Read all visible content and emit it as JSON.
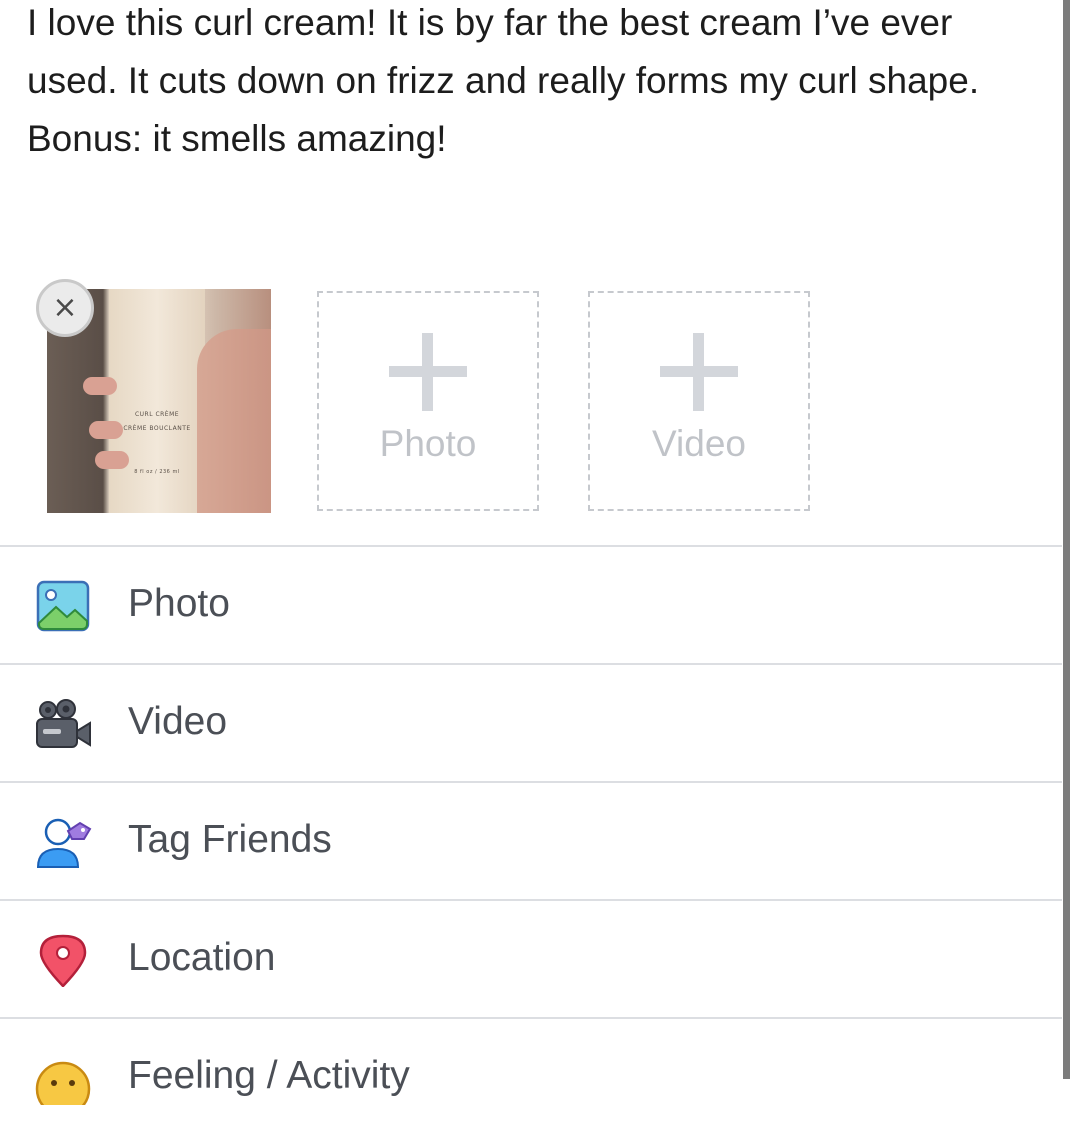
{
  "post": {
    "text": "I love this curl cream! It is by far the best cream I’ve ever used. It cuts down on frizz and really forms my curl shape. Bonus: it smells amazing!"
  },
  "attachments": {
    "photo_thumbnail": {
      "printed_text": [
        "CURL CRÈME",
        "CRÈME BOUCLANTE",
        "8 fl oz / 236 ml"
      ]
    },
    "remove_label": "×",
    "add_photo_label": "Photo",
    "add_video_label": "Video"
  },
  "menu": {
    "items": [
      {
        "label": "Photo",
        "icon": "photo-icon",
        "color": "#45bd62"
      },
      {
        "label": "Video",
        "icon": "video-camera-icon",
        "color": "#555a64"
      },
      {
        "label": "Tag Friends",
        "icon": "tag-friends-icon",
        "color": "#1877f2"
      },
      {
        "label": "Location",
        "icon": "location-pin-icon",
        "color": "#f3425f"
      },
      {
        "label": "Feeling / Activity",
        "icon": "feeling-emoji-icon",
        "color": "#f7b928"
      }
    ]
  }
}
